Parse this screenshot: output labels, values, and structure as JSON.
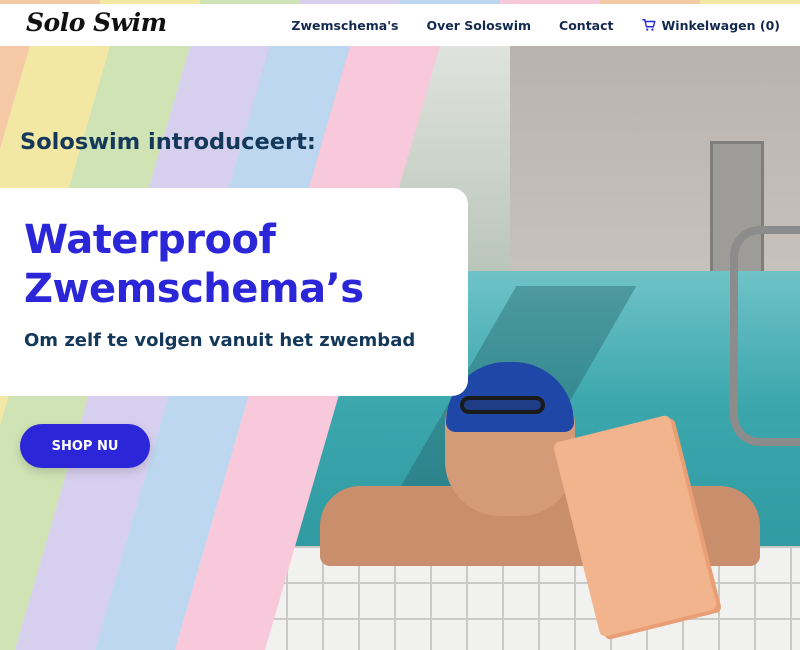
{
  "brand": {
    "logo_text": "Solo Swim"
  },
  "nav": {
    "items": [
      {
        "label": "Zwemschema's"
      },
      {
        "label": "Over Soloswim"
      },
      {
        "label": "Contact"
      }
    ],
    "cart_label": "Winkelwagen (0)",
    "cart_icon": "cart-icon"
  },
  "hero": {
    "intro": "Soloswim introduceert:",
    "title_line1": "Waterproof",
    "title_line2": "Zwemschema’s",
    "subtitle": "Om zelf te volgen vanuit het zwembad",
    "cta_label": "SHOP NU",
    "image_description": "swimmer-at-pool-edge-holding-waterproof-schedules"
  },
  "colors": {
    "accent": "#2b26d8",
    "heading_dark": "#14385a",
    "nav_text": "#14294f",
    "rainbow": [
      "#f8d8b8",
      "#f3e7a4",
      "#cfe3b5",
      "#d7cfee",
      "#bcd7ef",
      "#f8c9da"
    ]
  }
}
